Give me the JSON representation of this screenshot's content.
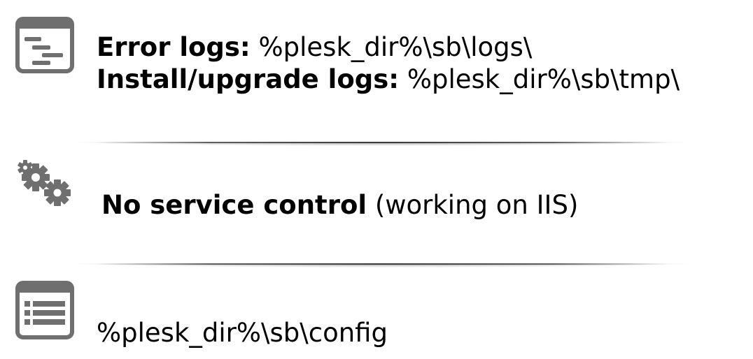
{
  "sections": [
    {
      "icon": "log-file-icon",
      "lines": [
        {
          "label": "Error logs:",
          "value": " %plesk_dir%\\sb\\logs\\"
        },
        {
          "label": "Install/upgrade logs:",
          "value": " %plesk_dir%\\sb\\tmp\\"
        }
      ]
    },
    {
      "icon": "gears-icon",
      "lines": [
        {
          "label": "No service control",
          "value": " (working on IIS)"
        }
      ]
    },
    {
      "icon": "config-file-icon",
      "lines": [
        {
          "label": "",
          "value": "%plesk_dir%\\sb\\config"
        }
      ]
    }
  ],
  "colors": {
    "icon_gray": "#6f6f6f",
    "text": "#000000"
  }
}
